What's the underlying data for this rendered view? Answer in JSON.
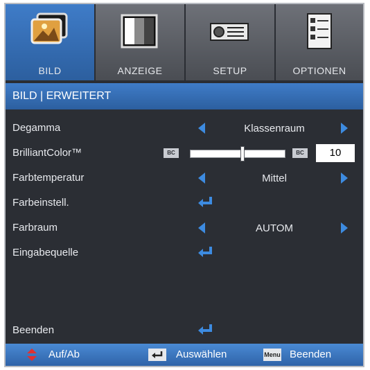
{
  "tabs": [
    {
      "label": "BILD",
      "icon": "picture-icon",
      "active": true
    },
    {
      "label": "ANZEIGE",
      "icon": "display-icon",
      "active": false
    },
    {
      "label": "SETUP",
      "icon": "projector-icon",
      "active": false
    },
    {
      "label": "OPTIONEN",
      "icon": "checklist-icon",
      "active": false
    }
  ],
  "breadcrumb": "BILD | ERWEITERT",
  "rows": {
    "degamma": {
      "label": "Degamma",
      "value": "Klassenraum"
    },
    "brilliantcolor": {
      "label": "BrilliantColor™",
      "value": "10",
      "level": 0.55,
      "left_icon": "BC",
      "right_icon": "BC"
    },
    "farbtemperatur": {
      "label": "Farbtemperatur",
      "value": "Mittel"
    },
    "farbeinstell": {
      "label": "Farbeinstell."
    },
    "farbraum": {
      "label": "Farbraum",
      "value": "AUTOM"
    },
    "eingabequelle": {
      "label": "Eingabequelle"
    },
    "beenden": {
      "label": "Beenden"
    }
  },
  "footer": {
    "updown_label": "Auf/Ab",
    "select_label": "Auswählen",
    "menu_key": "Menu",
    "exit_label": "Beenden"
  },
  "colors": {
    "accent": "#3d8be0",
    "panel": "#2b2e34",
    "highlight": "#2c5f9f"
  }
}
